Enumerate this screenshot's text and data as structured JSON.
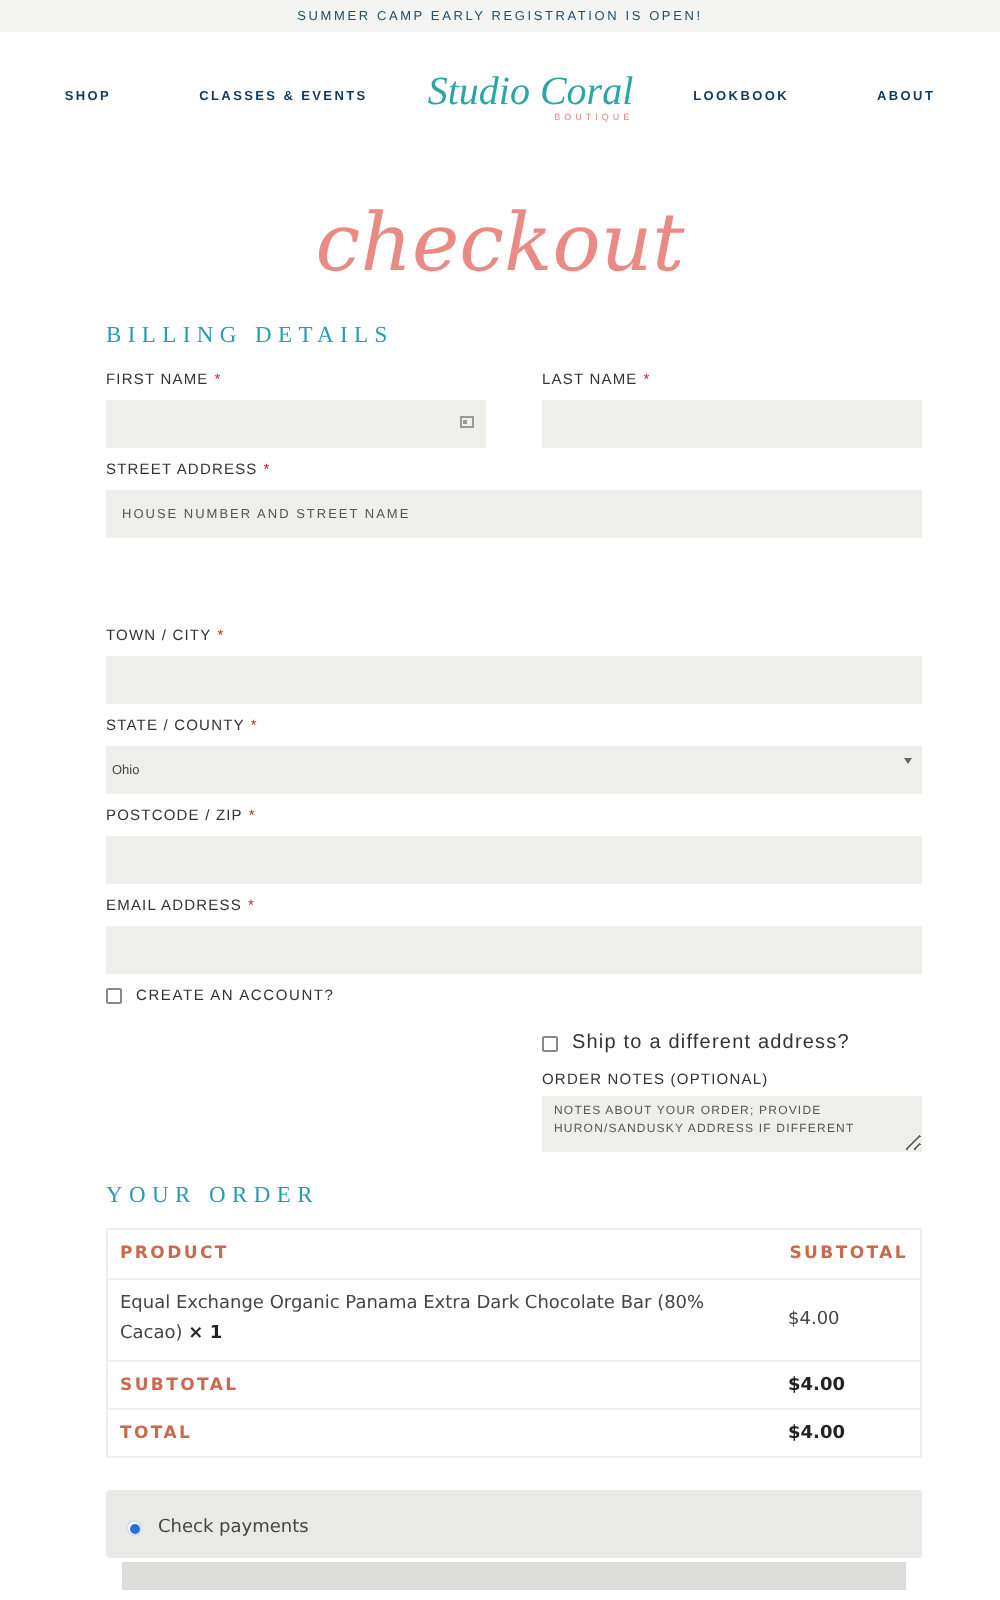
{
  "banner": "SUMMER CAMP EARLY REGISTRATION IS OPEN!",
  "nav": {
    "left": [
      "SHOP",
      "CLASSES & EVENTS"
    ],
    "logo": {
      "name": "Studio Coral",
      "sub": "BOUTIQUE"
    },
    "right": [
      "LOOKBOOK",
      "ABOUT"
    ]
  },
  "page_title": "checkout",
  "billing": {
    "heading": "BILLING DETAILS",
    "rows": [
      [
        {
          "label": "FIRST NAME",
          "required_mark": "*",
          "kind": "text"
        },
        {
          "label": "LAST NAME",
          "required_mark": "*",
          "kind": "text"
        }
      ],
      [
        {
          "label": "STREET ADDRESS",
          "required_mark": "*",
          "kind": "text",
          "placeholder": "HOUSE NUMBER AND STREET NAME"
        }
      ],
      [
        {
          "label": "TOWN / CITY",
          "required_mark": "*",
          "kind": "text"
        }
      ],
      [
        {
          "label": "STATE / COUNTY",
          "required_mark": "*",
          "kind": "select",
          "value": "Ohio"
        }
      ],
      [
        {
          "label": "POSTCODE / ZIP",
          "required_mark": "*",
          "kind": "text"
        }
      ],
      [
        {
          "label": "EMAIL ADDRESS",
          "required_mark": "*",
          "kind": "text"
        }
      ]
    ],
    "create_account": {
      "label": "CREATE AN ACCOUNT?",
      "checked": false
    }
  },
  "shipping": {
    "ship_different": {
      "label": "Ship to a different address?",
      "checked": false
    },
    "notes": {
      "label": "ORDER NOTES (OPTIONAL)",
      "placeholder": "NOTES ABOUT YOUR ORDER; PROVIDE HURON/SANDUSKY ADDRESS IF DIFFERENT"
    }
  },
  "order": {
    "heading": "YOUR ORDER",
    "columns": [
      "PRODUCT",
      "SUBTOTAL"
    ],
    "items": [
      {
        "name": "Equal Exchange Organic Panama Extra Dark Chocolate Bar (80% Cacao)",
        "qty": "× 1",
        "price": "$4.00"
      }
    ],
    "totals": [
      {
        "label": "SUBTOTAL",
        "value": "$4.00"
      },
      {
        "label": "TOTAL",
        "value": "$4.00"
      }
    ]
  },
  "payment": {
    "methods": [
      {
        "label": "Check payments",
        "selected": true
      }
    ]
  }
}
